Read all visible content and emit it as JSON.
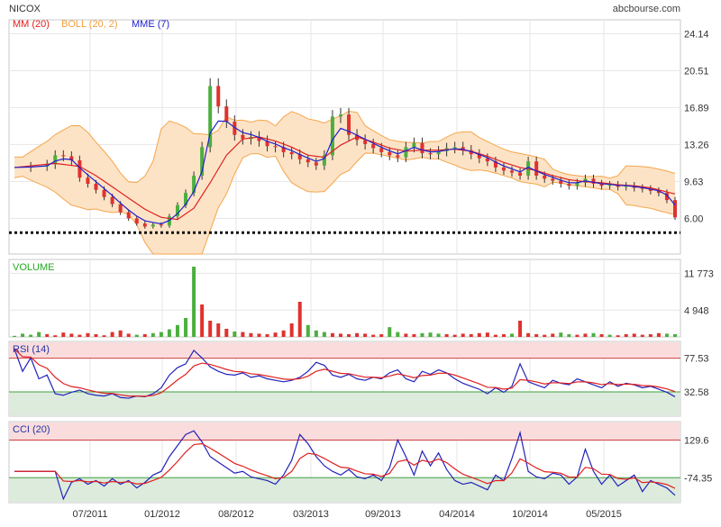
{
  "header": {
    "ticker": "NICOX",
    "source": "abcbourse.com"
  },
  "colors": {
    "up": "#4caf3e",
    "down": "#e0322d",
    "mm": "#e02020",
    "boll_fill": "#fde3c6",
    "boll_line": "#f5a54a",
    "mme": "#2020d0",
    "volume_label": "#22aa22",
    "rsi_line": "#2222bb",
    "rsi_signal": "#e02020",
    "zone_high": "#fadcdc",
    "zone_low": "#dcebdc",
    "grid": "#e6e6e6",
    "frame": "#c8c8c8",
    "text": "#333333"
  },
  "chart_data": [
    {
      "type": "line",
      "panel": "price",
      "chart_subtype": "candlestick",
      "legend": [
        {
          "label": "MM (20)",
          "color": "#e02020"
        },
        {
          "label": "BOLL (20, 2)",
          "color": "#f0a040"
        },
        {
          "label": "MME (7)",
          "color": "#2020d0"
        }
      ],
      "y_ticks": [
        "24.14",
        "20.51",
        "16.89",
        "13.26",
        "9.63",
        "6.00"
      ],
      "ylim": [
        2.5,
        25.5
      ],
      "x_ticks": [
        "07/2011",
        "01/2012",
        "08/2012",
        "03/2013",
        "09/2013",
        "04/2014",
        "10/2014",
        "05/2015"
      ],
      "support_level": 4.6,
      "close_series": [
        [
          0,
          11.0
        ],
        [
          2,
          11.1
        ],
        [
          4,
          11.3
        ],
        [
          5,
          12.2
        ],
        [
          6,
          12.1
        ],
        [
          7,
          11.7
        ],
        [
          8,
          10.0
        ],
        [
          9,
          9.4
        ],
        [
          10,
          8.8
        ],
        [
          11,
          8.1
        ],
        [
          12,
          7.4
        ],
        [
          13,
          6.6
        ],
        [
          14,
          6.0
        ],
        [
          15,
          5.5
        ],
        [
          16,
          5.2
        ],
        [
          17,
          5.4
        ],
        [
          18,
          5.3
        ],
        [
          19,
          6.2
        ],
        [
          20,
          7.3
        ],
        [
          21,
          8.5
        ],
        [
          22,
          10.2
        ],
        [
          23,
          13.0
        ],
        [
          24,
          19.0
        ],
        [
          25,
          17.0
        ],
        [
          26,
          15.5
        ],
        [
          27,
          14.2
        ],
        [
          28,
          13.8
        ],
        [
          29,
          14.0
        ],
        [
          30,
          13.6
        ],
        [
          31,
          13.1
        ],
        [
          32,
          13.0
        ],
        [
          33,
          12.5
        ],
        [
          34,
          12.3
        ],
        [
          35,
          11.8
        ],
        [
          36,
          11.5
        ],
        [
          37,
          11.2
        ],
        [
          38,
          12.2
        ],
        [
          39,
          16.0
        ],
        [
          40,
          16.2
        ],
        [
          41,
          14.2
        ],
        [
          42,
          13.7
        ],
        [
          43,
          13.3
        ],
        [
          44,
          12.9
        ],
        [
          45,
          12.5
        ],
        [
          46,
          12.2
        ],
        [
          47,
          12.0
        ],
        [
          48,
          13.0
        ],
        [
          49,
          13.4
        ],
        [
          50,
          12.4
        ],
        [
          51,
          12.3
        ],
        [
          52,
          12.6
        ],
        [
          53,
          12.9
        ],
        [
          54,
          13.0
        ],
        [
          55,
          12.7
        ],
        [
          56,
          12.3
        ],
        [
          57,
          11.9
        ],
        [
          58,
          11.6
        ],
        [
          59,
          11.0
        ],
        [
          60,
          10.7
        ],
        [
          61,
          10.5
        ],
        [
          62,
          10.2
        ],
        [
          63,
          11.6
        ],
        [
          64,
          10.2
        ],
        [
          65,
          9.9
        ],
        [
          66,
          9.7
        ],
        [
          67,
          9.4
        ],
        [
          68,
          9.2
        ],
        [
          69,
          9.5
        ],
        [
          70,
          9.9
        ],
        [
          71,
          9.4
        ],
        [
          72,
          9.2
        ],
        [
          73,
          9.3
        ],
        [
          74,
          9.1
        ],
        [
          75,
          9.2
        ],
        [
          76,
          9.0
        ],
        [
          77,
          8.9
        ],
        [
          78,
          8.7
        ],
        [
          79,
          8.5
        ],
        [
          80,
          7.8
        ],
        [
          81,
          6.1
        ]
      ],
      "mm20_series": [
        [
          0,
          11.0
        ],
        [
          5,
          11.4
        ],
        [
          8,
          11.1
        ],
        [
          10,
          10.2
        ],
        [
          12,
          9.1
        ],
        [
          14,
          8.0
        ],
        [
          16,
          6.9
        ],
        [
          18,
          6.1
        ],
        [
          20,
          5.9
        ],
        [
          22,
          7.0
        ],
        [
          24,
          9.5
        ],
        [
          26,
          12.2
        ],
        [
          28,
          13.8
        ],
        [
          30,
          14.0
        ],
        [
          32,
          13.6
        ],
        [
          34,
          13.0
        ],
        [
          36,
          12.2
        ],
        [
          38,
          12.0
        ],
        [
          40,
          13.2
        ],
        [
          42,
          14.0
        ],
        [
          44,
          13.5
        ],
        [
          46,
          12.9
        ],
        [
          48,
          12.6
        ],
        [
          50,
          12.7
        ],
        [
          52,
          12.7
        ],
        [
          54,
          12.8
        ],
        [
          56,
          12.6
        ],
        [
          58,
          12.1
        ],
        [
          60,
          11.5
        ],
        [
          62,
          11.0
        ],
        [
          64,
          10.7
        ],
        [
          66,
          10.2
        ],
        [
          68,
          9.8
        ],
        [
          70,
          9.6
        ],
        [
          72,
          9.5
        ],
        [
          74,
          9.3
        ],
        [
          76,
          9.2
        ],
        [
          78,
          9.0
        ],
        [
          80,
          8.6
        ],
        [
          81,
          8.4
        ]
      ]
    },
    {
      "type": "bar",
      "panel": "volume",
      "title": "VOLUME",
      "y_ticks": [
        "11 773",
        "4 948"
      ],
      "ylim": [
        0,
        13000
      ],
      "values": [
        200,
        600,
        400,
        900,
        500,
        300,
        800,
        600,
        400,
        700,
        500,
        300,
        900,
        1200,
        600,
        400,
        500,
        700,
        900,
        1400,
        2200,
        3500,
        13000,
        6000,
        3000,
        2500,
        1500,
        1000,
        900,
        700,
        600,
        500,
        800,
        1200,
        2500,
        6500,
        2200,
        1200,
        900,
        700,
        600,
        500,
        700,
        600,
        400,
        500,
        1800,
        900,
        600,
        500,
        700,
        800,
        600,
        500,
        400,
        600,
        500,
        700,
        800,
        400,
        500,
        600,
        3000,
        700,
        500,
        400,
        600,
        800,
        500,
        400,
        600,
        700,
        500,
        400,
        300,
        500,
        600,
        400,
        500,
        700,
        600,
        500
      ]
    },
    {
      "type": "line",
      "panel": "rsi",
      "title": "RSI (14)",
      "y_ticks": [
        "77.53",
        "32.58"
      ],
      "ylim": [
        0,
        100
      ],
      "high_level": 77.53,
      "low_level": 32.58,
      "series": [
        {
          "name": "RSI (14)",
          "values": [
            90,
            60,
            78,
            50,
            55,
            30,
            28,
            32,
            35,
            30,
            28,
            27,
            30,
            25,
            24,
            27,
            26,
            30,
            38,
            55,
            65,
            70,
            88,
            78,
            66,
            60,
            56,
            55,
            58,
            52,
            54,
            50,
            48,
            46,
            48,
            52,
            60,
            72,
            68,
            55,
            52,
            56,
            50,
            48,
            52,
            50,
            58,
            62,
            50,
            46,
            60,
            56,
            62,
            58,
            50,
            44,
            40,
            36,
            30,
            38,
            32,
            40,
            70,
            46,
            42,
            38,
            48,
            44,
            42,
            50,
            46,
            42,
            38,
            46,
            40,
            44,
            42,
            38,
            40,
            36,
            32,
            26
          ]
        }
      ]
    },
    {
      "type": "line",
      "panel": "cci",
      "title": "CCI (20)",
      "y_ticks": [
        "129.6",
        "-74.35"
      ],
      "ylim": [
        -210,
        230
      ],
      "high_level": 129.6,
      "low_level": -74.35,
      "series": [
        {
          "name": "CCI (20)",
          "values": [
            -40,
            -40,
            -40,
            -40,
            -40,
            -40,
            -190,
            -100,
            -80,
            -110,
            -90,
            -120,
            -80,
            -110,
            -90,
            -130,
            -100,
            -60,
            -40,
            40,
            100,
            160,
            180,
            120,
            40,
            10,
            -20,
            -50,
            -40,
            -70,
            -80,
            -90,
            -110,
            -60,
            20,
            160,
            110,
            40,
            -10,
            -40,
            -60,
            -30,
            -70,
            -80,
            -60,
            -90,
            -20,
            130,
            40,
            -60,
            70,
            -10,
            60,
            -30,
            -90,
            -110,
            -100,
            -120,
            -140,
            -60,
            -90,
            30,
            170,
            -40,
            -70,
            -80,
            -50,
            -60,
            -110,
            -70,
            80,
            -40,
            -110,
            -60,
            -120,
            -90,
            -60,
            -150,
            -90,
            -110,
            -130,
            -170
          ]
        }
      ]
    }
  ]
}
